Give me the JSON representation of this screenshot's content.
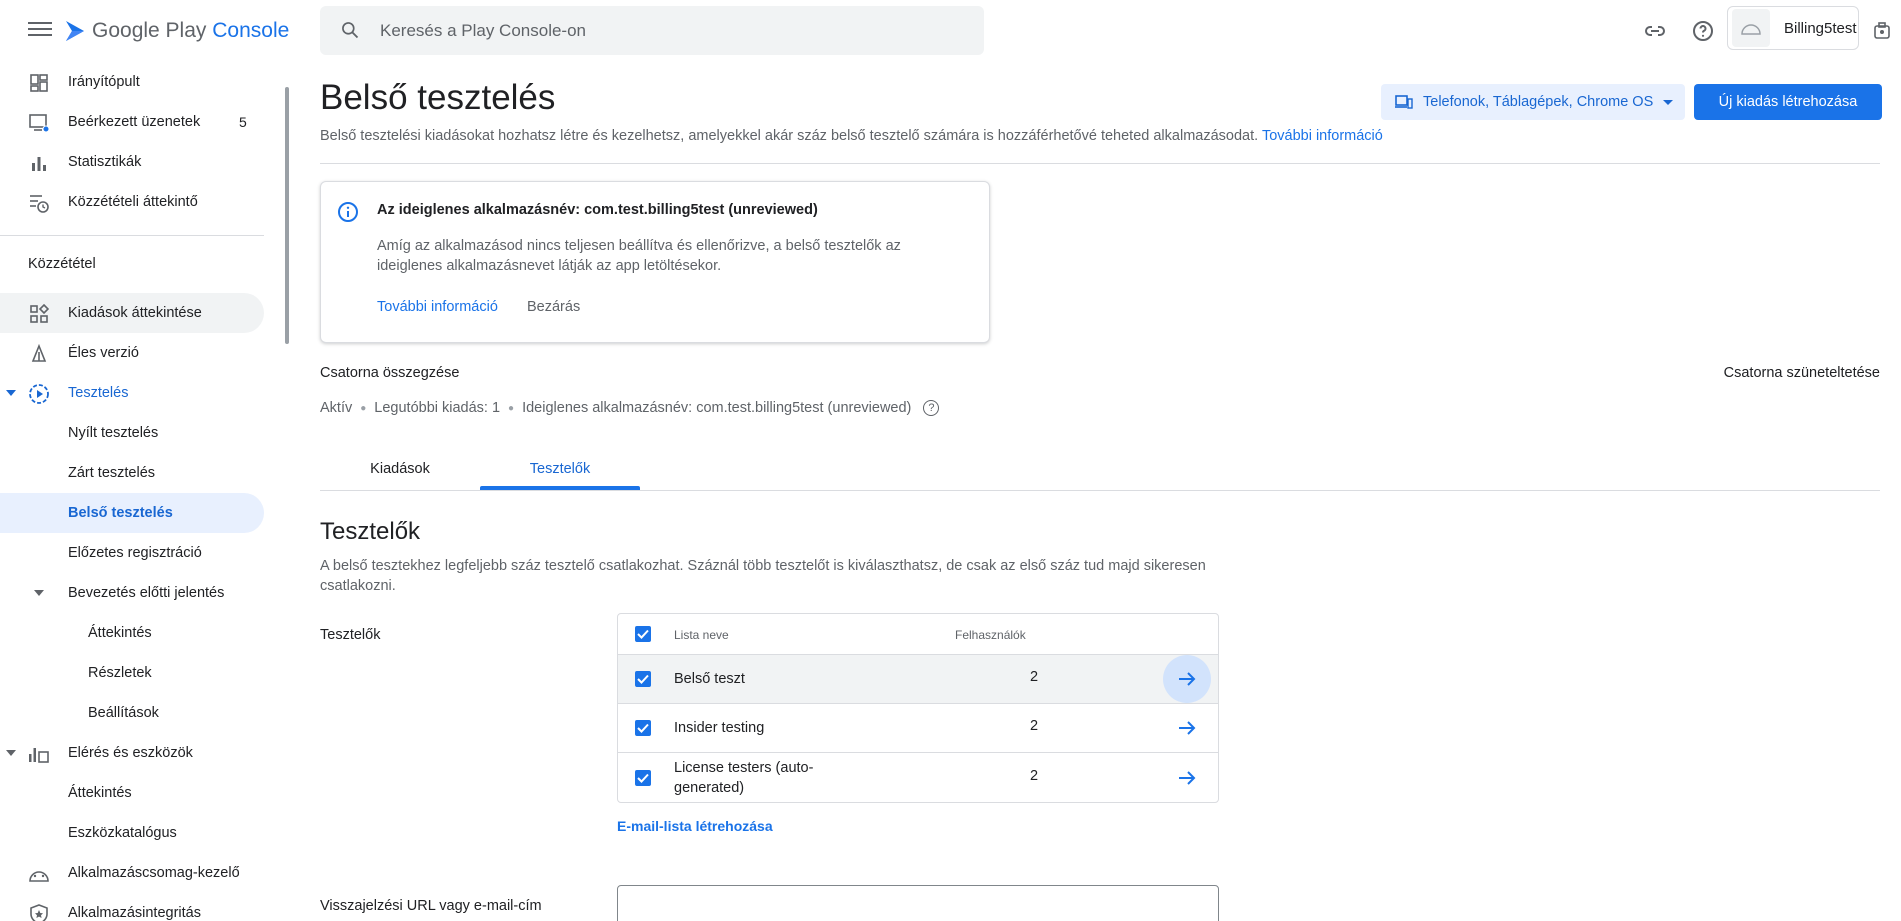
{
  "topbar": {
    "logo_google": "Google Play",
    "logo_console": "Console",
    "search_placeholder": "Keresés a Play Console-on",
    "account_name": "Billing5test"
  },
  "sidebar": {
    "items": [
      {
        "label": "Irányítópult",
        "icon": "dashboard-icon"
      },
      {
        "label": "Beérkezett üzenetek",
        "icon": "inbox-icon",
        "badge": "5"
      },
      {
        "label": "Statisztikák",
        "icon": "bar-chart-icon"
      },
      {
        "label": "Közzétételi áttekintő",
        "icon": "publishing-overview-icon"
      }
    ],
    "section_publish": "Közzététel",
    "publish_items": [
      {
        "label": "Kiadások áttekintése",
        "icon": "releases-overview-icon"
      },
      {
        "label": "Éles verzió",
        "icon": "production-icon"
      },
      {
        "label": "Tesztelés",
        "icon": "testing-icon"
      },
      {
        "label": "Nyílt tesztelés"
      },
      {
        "label": "Zárt tesztelés"
      },
      {
        "label": "Belső tesztelés"
      },
      {
        "label": "Előzetes regisztráció"
      },
      {
        "label": "Bevezetés előtti jelentés"
      },
      {
        "label": "Áttekintés"
      },
      {
        "label": "Részletek"
      },
      {
        "label": "Beállítások"
      },
      {
        "label": "Elérés és eszközök",
        "icon": "reach-devices-icon"
      },
      {
        "label": "Áttekintés"
      },
      {
        "label": "Eszközkatalógus"
      },
      {
        "label": "Alkalmazáscsomag-kezelő",
        "icon": "app-bundle-explorer-icon"
      },
      {
        "label": "Alkalmazásintegritás",
        "icon": "app-integrity-icon"
      }
    ]
  },
  "header": {
    "title": "Belső tesztelés",
    "description": "Belső tesztelési kiadásokat hozhatsz létre és kezelhetsz, amelyekkel akár száz belső tesztelő számára is hozzáférhetővé teheted alkalmazásodat.",
    "learn_more": "További információ",
    "device_selector": "Telefonok, Táblagépek, Chrome OS",
    "create_release": "Új kiadás létrehozása"
  },
  "info_card": {
    "title": "Az ideiglenes alkalmazásnév: com.test.billing5test (unreviewed)",
    "body": "Amíg az alkalmazásod nincs teljesen beállítva és ellenőrizve, a belső tesztelők az ideiglenes alkalmazásnevet látják az app letöltésekor.",
    "learn_more": "További információ",
    "dismiss": "Bezárás"
  },
  "track_summary": {
    "title": "Csatorna összegzése",
    "pause": "Csatorna szüneteltetése",
    "status": "Aktív",
    "latest_release": "Legutóbbi kiadás: 1",
    "temp_name": "Ideiglenes alkalmazásnév: com.test.billing5test (unreviewed)"
  },
  "tabs": [
    {
      "label": "Kiadások"
    },
    {
      "label": "Tesztelők"
    }
  ],
  "testers": {
    "title": "Tesztelők",
    "description": "A belső tesztekhez legfeljebb száz tesztelő csatlakozhat. Száznál több tesztelőt is kiválaszthatsz, de csak az első száz tud majd sikeresen csatlakozni.",
    "field_label": "Tesztelők",
    "col_list_name": "Lista neve",
    "col_users": "Felhasználók",
    "rows": [
      {
        "name": "Belső teszt",
        "users": "2"
      },
      {
        "name": "Insider testing",
        "users": "2"
      },
      {
        "name": "License testers (auto-generated)",
        "users": "2"
      }
    ],
    "create_list": "E-mail-lista létrehozása",
    "feedback_label": "Visszajelzési URL vagy e-mail-cím"
  },
  "colors": {
    "accent": "#1a73e8",
    "active_bg": "#e8f0fe",
    "text": "#202124",
    "muted": "#5f6368"
  }
}
